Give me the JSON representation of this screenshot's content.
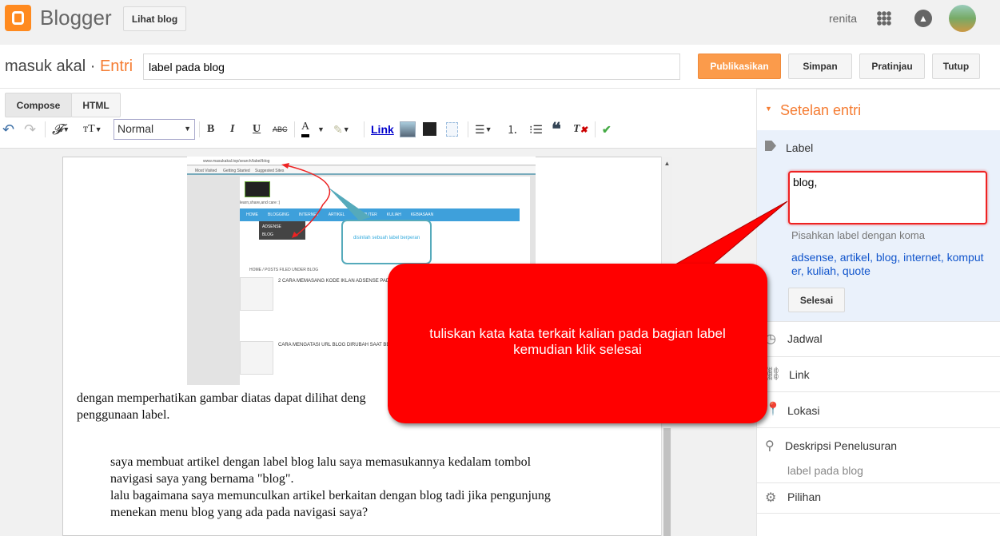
{
  "topbar": {
    "brand": "Blogger",
    "view_blog": "Lihat blog",
    "user": "renita"
  },
  "post": {
    "blog_name": "masuk akal",
    "separator": "·",
    "section": "Entri",
    "title_value": "label pada blog"
  },
  "actions": {
    "publish": "Publikasikan",
    "save": "Simpan",
    "preview": "Pratinjau",
    "close": "Tutup"
  },
  "editor": {
    "tabs": [
      "Compose",
      "HTML"
    ],
    "format_value": "Normal",
    "link_label": "Link",
    "embedded_image": {
      "url": "www.masukakal.top/search/label/blog",
      "bookmarks": [
        "Most Visited",
        "Getting Started",
        "Suggested Sites"
      ],
      "tagline": "learn,share,and care :)",
      "menu": [
        "HOME",
        "BLOGGING",
        "INTERNET",
        "ARTIKEL",
        "KOMPUTER",
        "KULIAH",
        "KEBIASAAN"
      ],
      "submenu": [
        "ADSENSE",
        "BLOG"
      ],
      "callout": "disinilah sebuah label berperan",
      "breadcrumb": "HOME / POSTS FILED UNDER BLOG",
      "posts": [
        "2 CARA MEMASANG KODE IKLAN ADSENSE PADA BLOG",
        "CARA MENGATASI URL BLOG DIRUBAH SAAT BELUM DI"
      ]
    },
    "paragraph1": "dengan memperhatikan gambar diatas dapat dilihat deng",
    "paragraph1b": "penggunaan label.",
    "quote": [
      "saya membuat artikel dengan label blog lalu saya memasukannya kedalam tombol",
      "navigasi saya yang bernama \"blog\".",
      "lalu bagaimana saya memunculkan artikel berkaitan dengan blog tadi jika pengunjung",
      "menekan menu blog yang ada pada navigasi saya?"
    ]
  },
  "sidebar": {
    "header": "Setelan entri",
    "label_title": "Label",
    "label_value": "blog,",
    "hint": "Pisahkan label dengan koma",
    "existing_labels": [
      "adsense",
      "artikel",
      "blog",
      "internet",
      "komputer",
      "kuliah",
      "quote"
    ],
    "done": "Selesai",
    "items": {
      "schedule": "Jadwal",
      "link": "Link",
      "location": "Lokasi",
      "search_desc": "Deskripsi Penelusuran",
      "search_desc_value": "label pada blog",
      "options": "Pilihan"
    }
  },
  "annotation": {
    "text": "tuliskan kata kata terkait kalian pada bagian label kemudian klik selesai",
    "color": "#ff0000"
  }
}
